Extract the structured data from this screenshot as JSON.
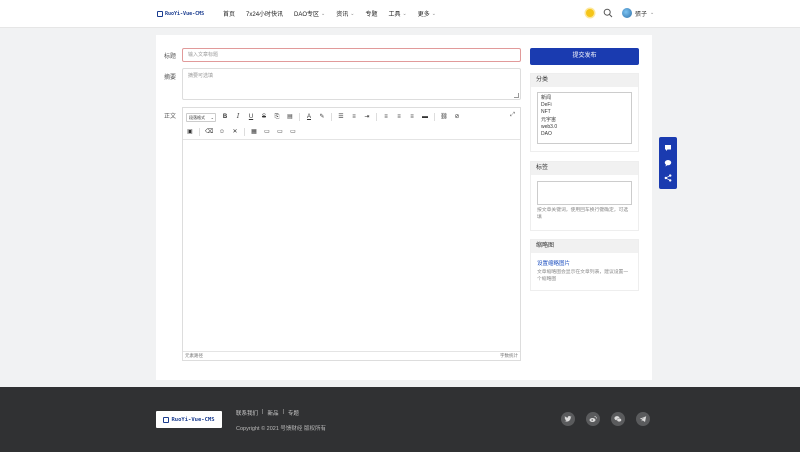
{
  "header": {
    "logo_text": "RuoYi-Vue-CMS",
    "nav": [
      {
        "label": "首页",
        "has_caret": false
      },
      {
        "label": "7x24小时快讯",
        "has_caret": false
      },
      {
        "label": "DAO专区",
        "has_caret": true
      },
      {
        "label": "资讯",
        "has_caret": true
      },
      {
        "label": "专题",
        "has_caret": false
      },
      {
        "label": "工具",
        "has_caret": true
      },
      {
        "label": "更多",
        "has_caret": true
      }
    ],
    "user_name": "張子"
  },
  "form": {
    "title_label": "标题",
    "title_placeholder": "输入文章标题",
    "summary_label": "摘要",
    "summary_placeholder": "摘要可选填",
    "body_label": "正文",
    "editor": {
      "block_format": "段落格式",
      "statusbar_left": "元素路径",
      "statusbar_right": "字数统计"
    }
  },
  "sidebar": {
    "publish_label": "提交发布",
    "category": {
      "title": "分类",
      "options": [
        "新闻",
        "DeFi",
        "NFT",
        "元宇宙",
        "web3.0",
        "DAO"
      ]
    },
    "tags": {
      "title": "标签",
      "hint": "按文章关键词，使用回车换行键确定，可选填"
    },
    "thumbnail": {
      "title": "缩略图",
      "link_label": "设置缩略图片",
      "hint": "文章缩略图会显示在文章列表，建议设置一个缩略图"
    }
  },
  "footer": {
    "logo_text": "RuoYi-Vue-CMS",
    "links": [
      "联系我们",
      "|",
      "新品",
      "|",
      "专题"
    ],
    "copyright": "Copyright © 2021 号馈财经 版权所有"
  },
  "colors": {
    "primary": "#1a3bb0",
    "footer_bg": "#303133",
    "title_border": "#e19a9a"
  }
}
